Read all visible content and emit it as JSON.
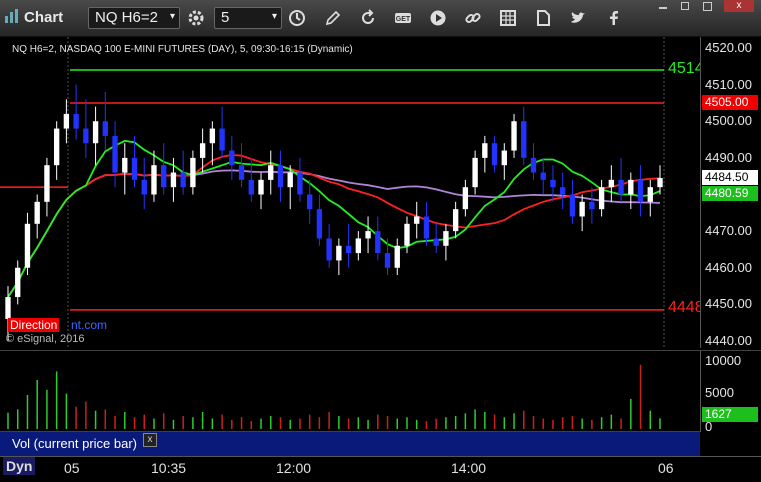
{
  "toolbar": {
    "title": "Chart",
    "symbol": "NQ H6=2",
    "interval": "5",
    "icons": [
      "clock-icon",
      "pencil-icon",
      "refresh-icon",
      "get-icon",
      "play-icon",
      "link-icon",
      "grid-icon",
      "twitter-icon",
      "facebook-icon"
    ]
  },
  "legend": "NQ H6=2, NASDAQ 100 E-MINI FUTURES (DAY), 5, 09:30-16:15 (Dynamic)",
  "copyright": "© eSignal, 2016",
  "direction_label": "Direction",
  "direction_label2": "nt.com",
  "price_scale": {
    "labels": [
      "4520.00",
      "4510.00",
      "4500.00",
      "4490.00",
      "4480.00",
      "4470.00",
      "4460.00",
      "4450.00",
      "4440.00"
    ]
  },
  "price_tags": {
    "red_level": "4505.00",
    "last_price": "4484.50",
    "ma_green": "4480.59",
    "green_level_text": "4514",
    "red_low_text": "4448"
  },
  "volume": {
    "label": "Vol (current price bar)",
    "close_glyph": "x",
    "scale": [
      "10000",
      "5000",
      "0"
    ],
    "current": "1627"
  },
  "time_axis": {
    "labels": [
      "05",
      "10:35",
      "12:00",
      "14:00",
      "06"
    ],
    "mode": "Dyn"
  },
  "colors": {
    "up_candle": "#ffffff",
    "down_candle": "#2233ff",
    "red_line": "#ff2020",
    "green_line": "#22ee22",
    "purple_line": "#b084d8",
    "vol_up": "#2ecc2e",
    "vol_down": "#cc2020"
  },
  "chart_data": {
    "type": "candlestick",
    "title": "NQ H6=2, NASDAQ 100 E-MINI FUTURES (DAY), 5, 09:30-16:15 (Dynamic)",
    "ylim": [
      4440,
      4522
    ],
    "x_ticks": [
      "05",
      "10:35",
      "12:00",
      "14:00",
      "06"
    ],
    "horizontal_levels": [
      {
        "value": 4514,
        "color": "#22ee22"
      },
      {
        "value": 4505,
        "color": "#ff2020"
      },
      {
        "value": 4448.5,
        "color": "#ff2020"
      }
    ],
    "candles": [
      [
        4446,
        4455,
        4440,
        4452
      ],
      [
        4452,
        4462,
        4450,
        4460
      ],
      [
        4460,
        4475,
        4458,
        4472
      ],
      [
        4472,
        4480,
        4468,
        4478
      ],
      [
        4478,
        4490,
        4474,
        4488
      ],
      [
        4488,
        4500,
        4484,
        4498
      ],
      [
        4498,
        4506,
        4494,
        4502
      ],
      [
        4502,
        4510,
        4495,
        4498
      ],
      [
        4498,
        4506,
        4490,
        4494
      ],
      [
        4494,
        4504,
        4488,
        4500
      ],
      [
        4500,
        4508,
        4492,
        4496
      ],
      [
        4496,
        4500,
        4482,
        4486
      ],
      [
        4486,
        4494,
        4480,
        4490
      ],
      [
        4490,
        4496,
        4482,
        4484
      ],
      [
        4484,
        4490,
        4476,
        4480
      ],
      [
        4480,
        4492,
        4478,
        4488
      ],
      [
        4488,
        4494,
        4480,
        4482
      ],
      [
        4482,
        4490,
        4478,
        4486
      ],
      [
        4486,
        4492,
        4480,
        4482
      ],
      [
        4482,
        4492,
        4480,
        4490
      ],
      [
        4490,
        4498,
        4486,
        4494
      ],
      [
        4494,
        4500,
        4488,
        4498
      ],
      [
        4498,
        4504,
        4490,
        4492
      ],
      [
        4492,
        4496,
        4484,
        4488
      ],
      [
        4488,
        4494,
        4482,
        4484
      ],
      [
        4484,
        4490,
        4478,
        4480
      ],
      [
        4480,
        4486,
        4476,
        4484
      ],
      [
        4484,
        4492,
        4480,
        4488
      ],
      [
        4488,
        4492,
        4478,
        4482
      ],
      [
        4482,
        4488,
        4476,
        4486
      ],
      [
        4486,
        4490,
        4478,
        4480
      ],
      [
        4480,
        4484,
        4472,
        4476
      ],
      [
        4476,
        4480,
        4466,
        4468
      ],
      [
        4468,
        4472,
        4460,
        4462
      ],
      [
        4462,
        4468,
        4458,
        4466
      ],
      [
        4466,
        4472,
        4460,
        4464
      ],
      [
        4464,
        4470,
        4462,
        4468
      ],
      [
        4468,
        4474,
        4464,
        4470
      ],
      [
        4470,
        4474,
        4462,
        4464
      ],
      [
        4464,
        4468,
        4458,
        4460
      ],
      [
        4460,
        4468,
        4458,
        4466
      ],
      [
        4466,
        4474,
        4464,
        4472
      ],
      [
        4472,
        4478,
        4468,
        4474
      ],
      [
        4474,
        4478,
        4466,
        4468
      ],
      [
        4468,
        4472,
        4464,
        4466
      ],
      [
        4466,
        4472,
        4462,
        4470
      ],
      [
        4470,
        4478,
        4468,
        4476
      ],
      [
        4476,
        4484,
        4474,
        4482
      ],
      [
        4482,
        4492,
        4480,
        4490
      ],
      [
        4490,
        4496,
        4486,
        4494
      ],
      [
        4494,
        4496,
        4486,
        4488
      ],
      [
        4488,
        4494,
        4484,
        4492
      ],
      [
        4492,
        4502,
        4490,
        4500
      ],
      [
        4500,
        4504,
        4488,
        4490
      ],
      [
        4490,
        4494,
        4484,
        4486
      ],
      [
        4486,
        4490,
        4480,
        4484
      ],
      [
        4484,
        4488,
        4478,
        4482
      ],
      [
        4482,
        4486,
        4476,
        4480
      ],
      [
        4480,
        4484,
        4472,
        4474
      ],
      [
        4474,
        4480,
        4470,
        4478
      ],
      [
        4478,
        4482,
        4472,
        4476
      ],
      [
        4476,
        4484,
        4474,
        4482
      ],
      [
        4482,
        4488,
        4478,
        4484
      ],
      [
        4484,
        4490,
        4478,
        4480
      ],
      [
        4480,
        4486,
        4476,
        4484
      ],
      [
        4484,
        4488,
        4474,
        4478
      ],
      [
        4478,
        4484,
        4474,
        4482
      ],
      [
        4482,
        4488,
        4480,
        4484.5
      ]
    ],
    "volume": [
      2500,
      3000,
      5200,
      7500,
      6000,
      8800,
      5400,
      3400,
      4200,
      2800,
      3000,
      2000,
      2600,
      1800,
      2200,
      1600,
      2400,
      1400,
      2000,
      1800,
      2600,
      1600,
      2200,
      1400,
      1800,
      1200,
      1600,
      2000,
      1800,
      1400,
      1600,
      2200,
      1800,
      2600,
      2000,
      1600,
      1800,
      1400,
      2200,
      2000,
      1600,
      1800,
      1400,
      1200,
      1600,
      1800,
      2000,
      2400,
      3000,
      2600,
      2200,
      1800,
      2400,
      2800,
      2000,
      1600,
      1400,
      1800,
      2000,
      1600,
      1400,
      1800,
      2200,
      1600,
      4600,
      9800,
      2800,
      1627
    ],
    "volume_ylim": [
      0,
      11000
    ]
  }
}
